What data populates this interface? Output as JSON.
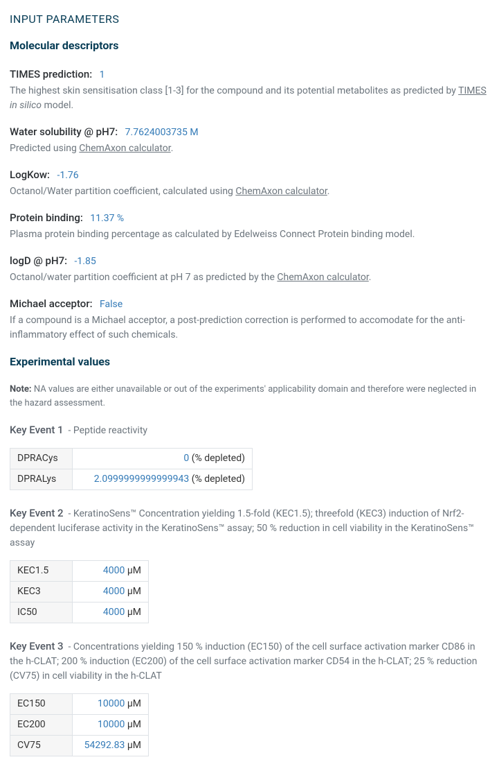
{
  "headings": {
    "input_parameters": "INPUT PARAMETERS",
    "molecular_descriptors": "Molecular descriptors",
    "experimental_values": "Experimental values"
  },
  "md": {
    "times": {
      "label": "TIMES prediction:",
      "value": "1",
      "desc_pre": "The highest skin sensitisation class [1-3] for the compound and its potential metabolites as predicted by ",
      "link": "TIMES",
      "desc_mid": " ",
      "ital": "in silico",
      "desc_post": " model."
    },
    "water": {
      "label": "Water solubility @ pH7:",
      "value": "7.7624003735 M",
      "desc_pre": "Predicted using ",
      "link": "ChemAxon calculator",
      "desc_post": "."
    },
    "logkow": {
      "label": "LogKow:",
      "value": "-1.76",
      "desc_pre": "Octanol/Water partition coefficient, calculated using ",
      "link": "ChemAxon calculator",
      "desc_post": "."
    },
    "protein": {
      "label": "Protein binding:",
      "value": "11.37 %",
      "desc": "Plasma protein binding percentage as calculated by Edelweiss Connect Protein binding model."
    },
    "logd": {
      "label": "logD @ pH7:",
      "value": "-1.85",
      "desc_pre": "Octanol/water partition coefficient at pH 7 as predicted by the ",
      "link": "ChemAxon calculator",
      "desc_post": "."
    },
    "michael": {
      "label": "Michael acceptor:",
      "value": "False",
      "desc": "If a compound is a Michael acceptor, a post-prediction correction is performed to accomodate for the anti-inflammatory effect of such chemicals."
    }
  },
  "note": {
    "bold": "Note:",
    "text": " NA values are either unavailable or out of the experiments' applicability domain and therefore were neglected in the hazard assessment."
  },
  "ev": {
    "ke1": {
      "title": "Key Event 1",
      "sep": "  - ",
      "sub": "Peptide reactivity",
      "rows": [
        {
          "name": "DPRACys",
          "num": "0",
          "unit": " (% depleted)"
        },
        {
          "name": "DPRALys",
          "num": "2.0999999999999943",
          "unit": " (% depleted)"
        }
      ]
    },
    "ke2": {
      "title": "Key Event 2",
      "sep": "  - ",
      "sub": "KeratinoSens™ Concentration yielding 1.5-fold (KEC1.5); threefold (KEC3) induction of Nrf2-dependent luciferase activity in the KeratinoSens™ assay; 50 % reduction in cell viability in the KeratinoSens™ assay",
      "rows": [
        {
          "name": "KEC1.5",
          "num": "4000",
          "unit": " µM"
        },
        {
          "name": "KEC3",
          "num": "4000",
          "unit": " µM"
        },
        {
          "name": "IC50",
          "num": "4000",
          "unit": " µM"
        }
      ]
    },
    "ke3": {
      "title": "Key Event 3",
      "sep": "  - ",
      "sub": "Concentrations yielding 150 % induction (EC150) of the cell surface activation marker CD86 in the h-CLAT; 200 % induction (EC200) of the cell surface activation marker CD54 in the h-CLAT; 25 % reduction (CV75) in cell viability in the h-CLAT",
      "rows": [
        {
          "name": "EC150",
          "num": "10000",
          "unit": " µM"
        },
        {
          "name": "EC200",
          "num": "10000",
          "unit": " µM"
        },
        {
          "name": "CV75",
          "num": "54292.83",
          "unit": " µM"
        }
      ]
    }
  }
}
